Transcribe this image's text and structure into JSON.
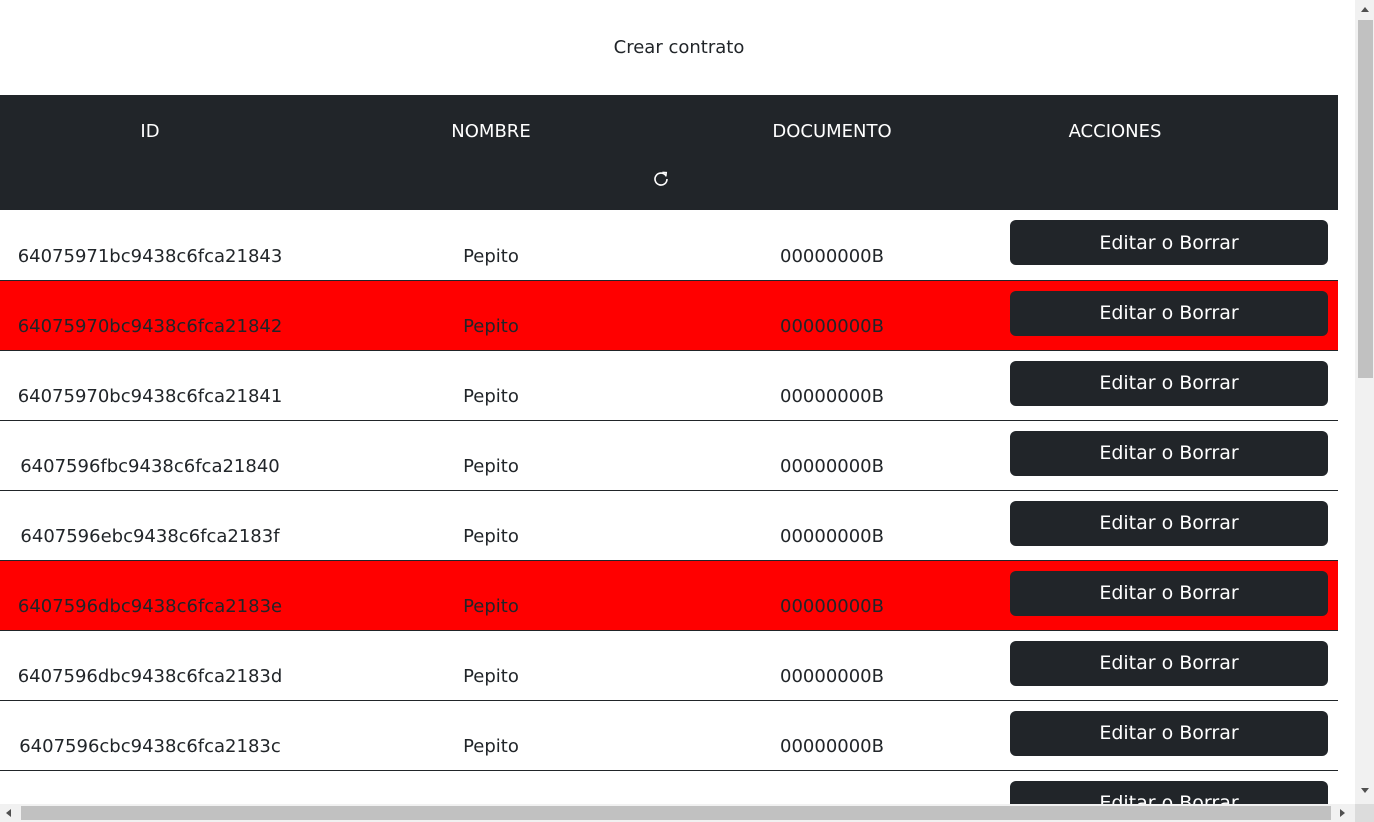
{
  "header": {
    "create_label": "Crear contrato"
  },
  "table": {
    "columns": [
      "ID",
      "NOMBRE",
      "DOCUMENTO",
      "ACCIONES"
    ],
    "refresh_icon": "refresh-icon",
    "action_label": "Editar o Borrar",
    "highlight_color": "#ff0000",
    "header_color": "#212529",
    "rows": [
      {
        "id": "64075971bc9438c6fca21843",
        "nombre": "Pepito",
        "documento": "00000000B",
        "highlighted": false
      },
      {
        "id": "64075970bc9438c6fca21842",
        "nombre": "Pepito",
        "documento": "00000000B",
        "highlighted": true
      },
      {
        "id": "64075970bc9438c6fca21841",
        "nombre": "Pepito",
        "documento": "00000000B",
        "highlighted": false
      },
      {
        "id": "6407596fbc9438c6fca21840",
        "nombre": "Pepito",
        "documento": "00000000B",
        "highlighted": false
      },
      {
        "id": "6407596ebc9438c6fca2183f",
        "nombre": "Pepito",
        "documento": "00000000B",
        "highlighted": false
      },
      {
        "id": "6407596dbc9438c6fca2183e",
        "nombre": "Pepito",
        "documento": "00000000B",
        "highlighted": true
      },
      {
        "id": "6407596dbc9438c6fca2183d",
        "nombre": "Pepito",
        "documento": "00000000B",
        "highlighted": false
      },
      {
        "id": "6407596cbc9438c6fca2183c",
        "nombre": "Pepito",
        "documento": "00000000B",
        "highlighted": false
      },
      {
        "id": "",
        "nombre": "",
        "documento": "",
        "highlighted": false
      }
    ]
  }
}
